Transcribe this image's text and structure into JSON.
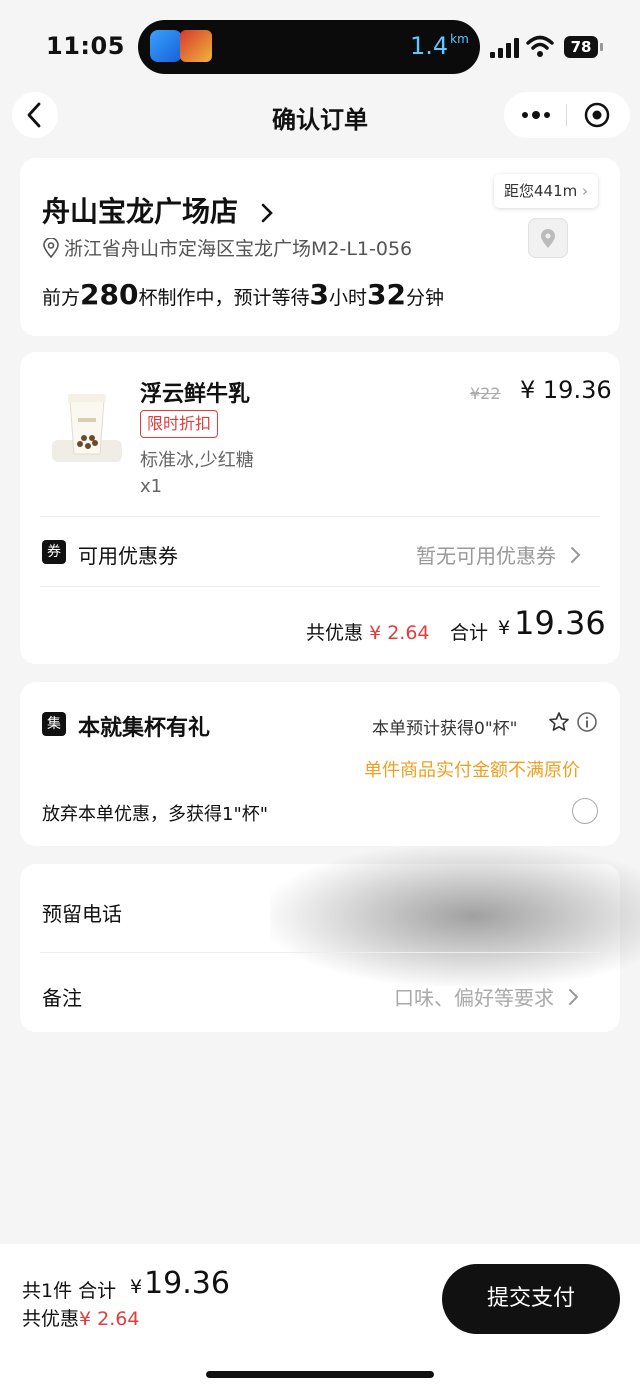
{
  "status": {
    "time": "11:05",
    "distance": "1.4",
    "distance_unit": "km",
    "battery": "78"
  },
  "nav": {
    "title": "确认订单"
  },
  "store": {
    "name": "舟山宝龙广场店",
    "address": "浙江省舟山市定海区宝龙广场M2-L1-056",
    "queue_prefix": "前方",
    "queue_count": "280",
    "queue_mid": "杯制作中，预计等待",
    "wait_hours": "3",
    "hours_unit": "小时",
    "wait_minutes": "32",
    "minutes_unit": "分钟",
    "distance_tag": "距您441m"
  },
  "product": {
    "name": "浮云鲜牛乳",
    "badge": "限时折扣",
    "spec": "标准冰,少红糖",
    "qty": "x1",
    "original_price": "¥22",
    "price": "¥ 19.36"
  },
  "coupon": {
    "icon_text": "券",
    "label": "可用优惠券",
    "value": "暂无可用优惠券"
  },
  "summary": {
    "discount_label": "共优惠",
    "discount_value": "¥ 2.64",
    "total_label": "合计",
    "currency": "¥",
    "total_value": "19.36"
  },
  "collect": {
    "icon_text": "集",
    "title": "本就集杯有礼",
    "estimate": "本单预计获得0\"杯\"",
    "warning": "单件商品实付金额不满原价",
    "giveup": "放弃本单优惠，多获得1\"杯\""
  },
  "contact": {
    "phone_label": "预留电话",
    "remark_label": "备注",
    "remark_placeholder": "口味、偏好等要求"
  },
  "bottom": {
    "count_label": "共1件  合计",
    "currency": "¥",
    "total": "19.36",
    "discount_label": "共优惠",
    "discount_value": "¥ 2.64",
    "pay_label": "提交支付"
  },
  "colors": {
    "accent_red": "#e23c3c",
    "warning_orange": "#f0a020",
    "primary_dark": "#111111"
  }
}
